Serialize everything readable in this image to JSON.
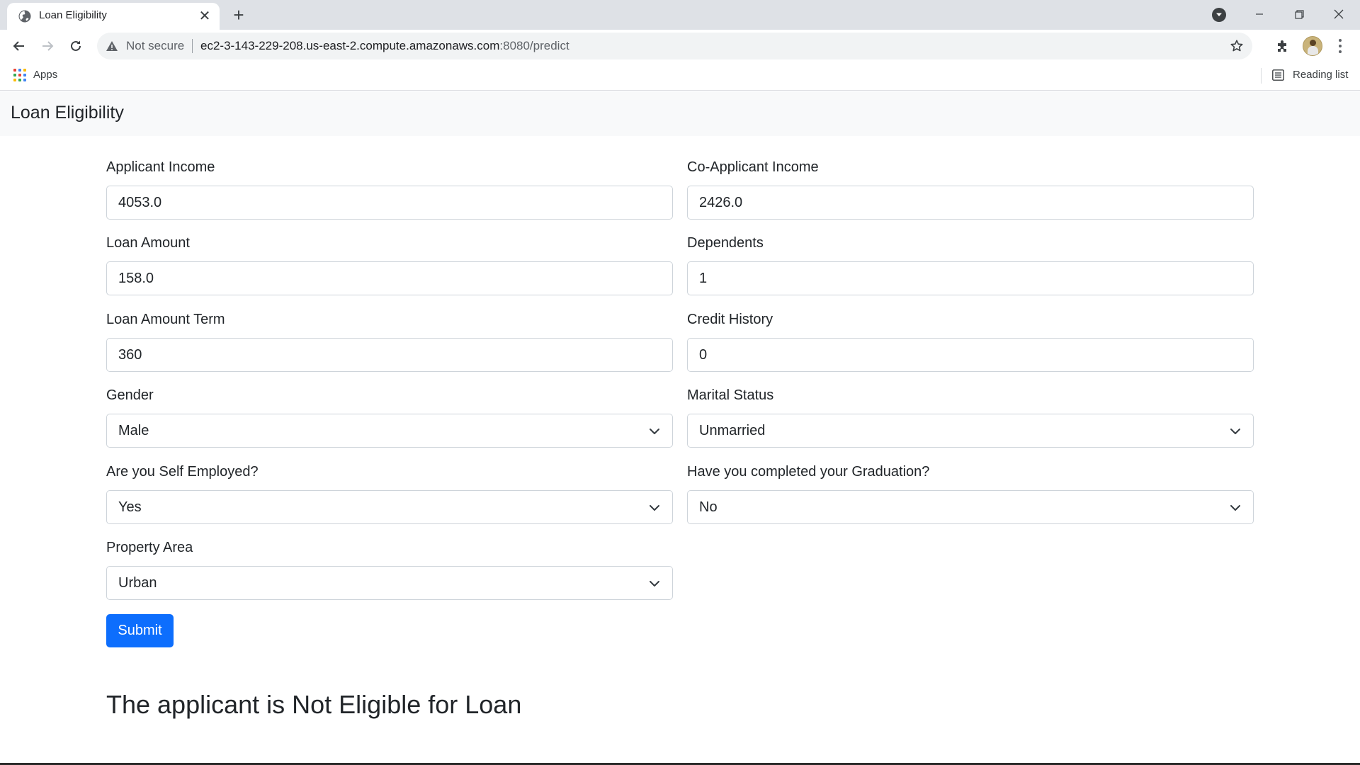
{
  "browser": {
    "tab_title": "Loan Eligibility",
    "url_host": "ec2-3-143-229-208.us-east-2.compute.amazonaws.com",
    "url_rest": ":8080/predict",
    "security_text": "Not secure",
    "bookmarks": {
      "apps_label": "Apps"
    },
    "reading_list_label": "Reading list"
  },
  "navbar": {
    "brand": "Loan Eligibility"
  },
  "form": {
    "applicant_income": {
      "label": "Applicant Income",
      "value": "4053.0"
    },
    "coapplicant_income": {
      "label": "Co-Applicant Income",
      "value": "2426.0"
    },
    "loan_amount": {
      "label": "Loan Amount",
      "value": "158.0"
    },
    "dependents": {
      "label": "Dependents",
      "value": "1"
    },
    "loan_amount_term": {
      "label": "Loan Amount Term",
      "value": "360"
    },
    "credit_history": {
      "label": "Credit History",
      "value": "0"
    },
    "gender": {
      "label": "Gender",
      "selected": "Male"
    },
    "marital_status": {
      "label": "Marital Status",
      "selected": "Unmarried"
    },
    "self_employed": {
      "label": "Are you Self Employed?",
      "selected": "Yes"
    },
    "graduation": {
      "label": "Have you completed your Graduation?",
      "selected": "No"
    },
    "property_area": {
      "label": "Property Area",
      "selected": "Urban"
    },
    "submit_label": "Submit"
  },
  "result": {
    "text": "The applicant is Not Eligible for Loan"
  },
  "colors": {
    "primary": "#0d6efd",
    "navbar_bg": "#f8f9fa",
    "tabstrip_bg": "#dee1e6"
  }
}
